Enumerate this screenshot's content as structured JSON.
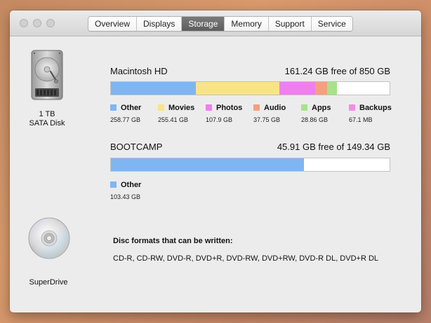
{
  "tabs": [
    {
      "label": "Overview",
      "active": false
    },
    {
      "label": "Displays",
      "active": false
    },
    {
      "label": "Storage",
      "active": true
    },
    {
      "label": "Memory",
      "active": false
    },
    {
      "label": "Support",
      "active": false
    },
    {
      "label": "Service",
      "active": false
    }
  ],
  "hdd": {
    "icon": "hard-drive-icon",
    "label_line1": "1 TB",
    "label_line2": "SATA Disk"
  },
  "volumes": [
    {
      "name": "Macintosh HD",
      "free": "161.24 GB free of 850 GB",
      "capacity_gb": 850,
      "segments": [
        {
          "label": "Other",
          "size": "258.77 GB",
          "gb": 258.77,
          "color": "#7fb6f1"
        },
        {
          "label": "Movies",
          "size": "255.41 GB",
          "gb": 255.41,
          "color": "#f8e487"
        },
        {
          "label": "Photos",
          "size": "107.9 GB",
          "gb": 107.9,
          "color": "#ef7fee"
        },
        {
          "label": "Audio",
          "size": "37.75 GB",
          "gb": 37.75,
          "color": "#f4a07f"
        },
        {
          "label": "Apps",
          "size": "28.86 GB",
          "gb": 28.86,
          "color": "#a6e38a"
        },
        {
          "label": "Backups",
          "size": "67.1 MB",
          "gb": 0.0671,
          "color": "#f08fe2"
        }
      ]
    },
    {
      "name": "BOOTCAMP",
      "free": "45.91 GB free of 149.34 GB",
      "capacity_gb": 149.34,
      "segments": [
        {
          "label": "Other",
          "size": "103.43 GB",
          "gb": 103.43,
          "color": "#7fb6f1"
        }
      ]
    }
  ],
  "superdrive": {
    "icon": "optical-disc-icon",
    "label": "SuperDrive",
    "disc_formats_title": "Disc formats that can be written:",
    "disc_formats": "CD-R, CD-RW, DVD-R, DVD+R, DVD-RW, DVD+RW, DVD-R DL, DVD+R DL"
  }
}
